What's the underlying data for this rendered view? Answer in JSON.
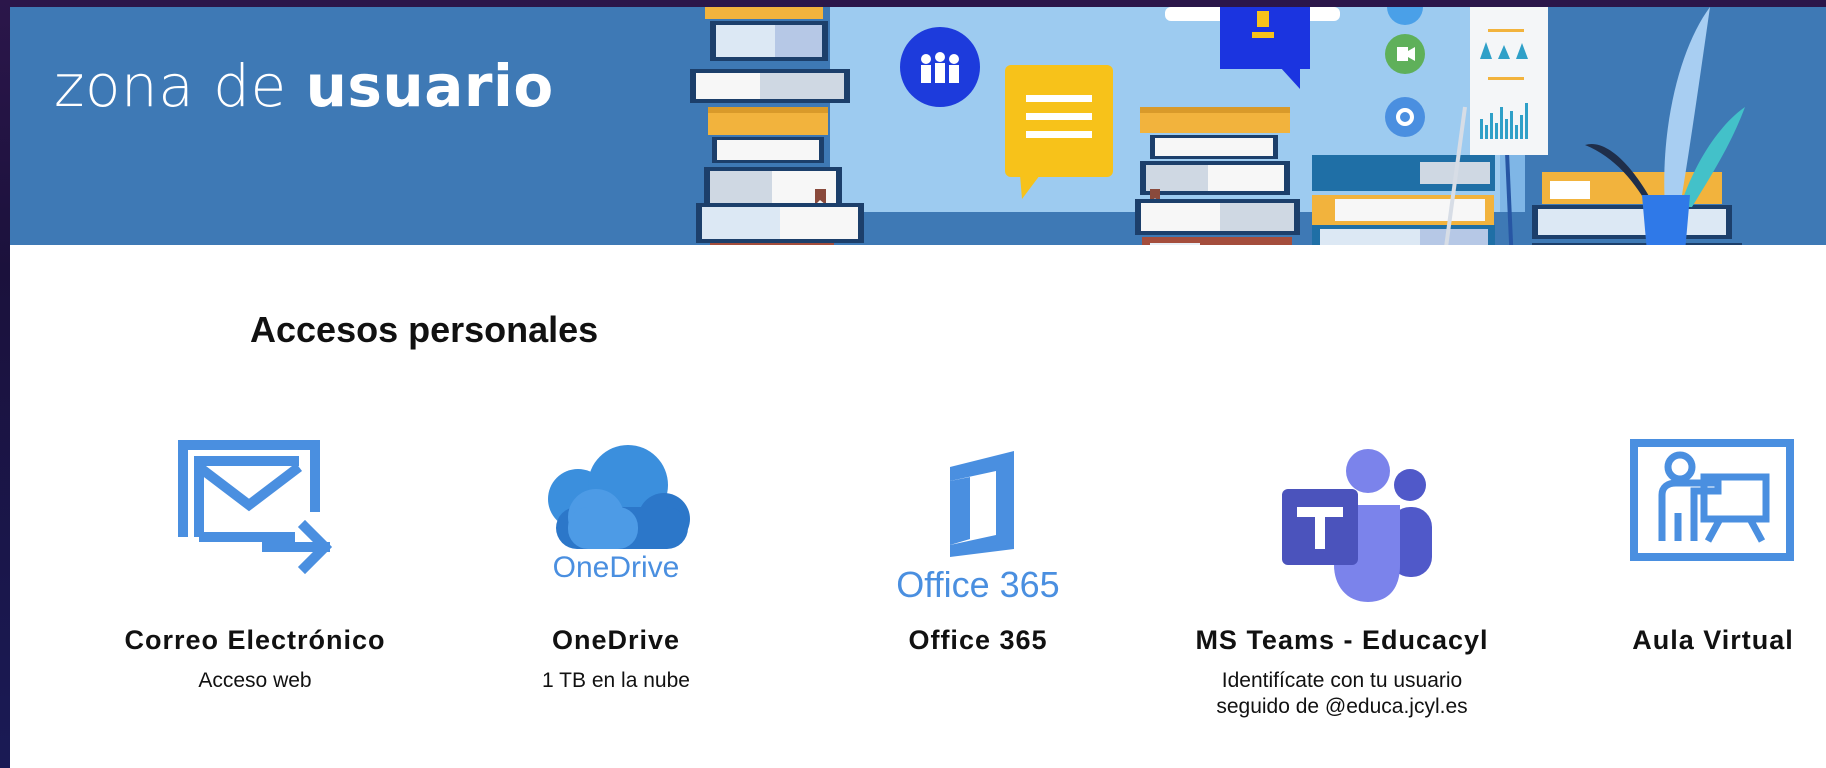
{
  "header": {
    "brand_prefix": "zona de ",
    "brand_bold": "usuario"
  },
  "section": {
    "title": "Accesos personales"
  },
  "tiles": [
    {
      "icon": "mail-forward-icon",
      "title": "Correo Electrónico",
      "subtitle": "Acceso web"
    },
    {
      "icon": "onedrive-cloud-icon",
      "icon_text": "OneDrive",
      "title": "OneDrive",
      "subtitle": "1 TB en la nube"
    },
    {
      "icon": "office365-icon",
      "icon_text": "Office 365",
      "title": "Office 365",
      "subtitle": ""
    },
    {
      "icon": "ms-teams-icon",
      "title": "MS Teams - Educacyl",
      "subtitle_lines": [
        "Identifícate con tu usuario",
        "seguido de @educa.jcyl.es"
      ]
    },
    {
      "icon": "virtual-classroom-icon",
      "title": "Aula Virtual",
      "subtitle": ""
    }
  ],
  "colors": {
    "header_blue": "#3e79b5",
    "accent_blue": "#4a8fe0",
    "teams_purple": "#5b5fc7",
    "white": "#ffffff",
    "text": "#111111"
  }
}
